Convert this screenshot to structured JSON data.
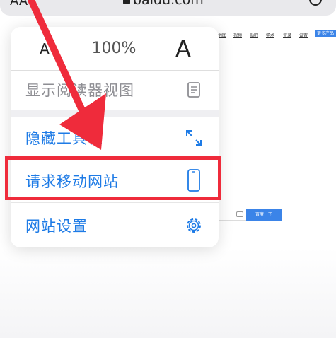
{
  "browser": {
    "aa_label": "AA",
    "url": "baidu.com"
  },
  "background_page": {
    "nav_links": [
      "地图",
      "视频",
      "贴吧",
      "学术",
      "登录",
      "设置"
    ],
    "more_button": "更多产品",
    "search_button": "百度一下"
  },
  "menu": {
    "zoom": {
      "decrease_label": "A",
      "percent": "100%",
      "increase_label": "A"
    },
    "items": [
      {
        "label": "显示阅读器视图",
        "icon": "reader-view-icon",
        "enabled": false
      },
      {
        "label": "隐藏工具栏",
        "icon": "expand-arrows-icon",
        "enabled": true
      },
      {
        "label": "请求移动网站",
        "icon": "phone-icon",
        "enabled": true
      },
      {
        "label": "网站设置",
        "icon": "gear-icon",
        "enabled": true
      }
    ]
  },
  "colors": {
    "accent_blue": "#1e7be6",
    "annotation_red": "#ef2b3b",
    "disabled_gray": "#8e8e93"
  }
}
